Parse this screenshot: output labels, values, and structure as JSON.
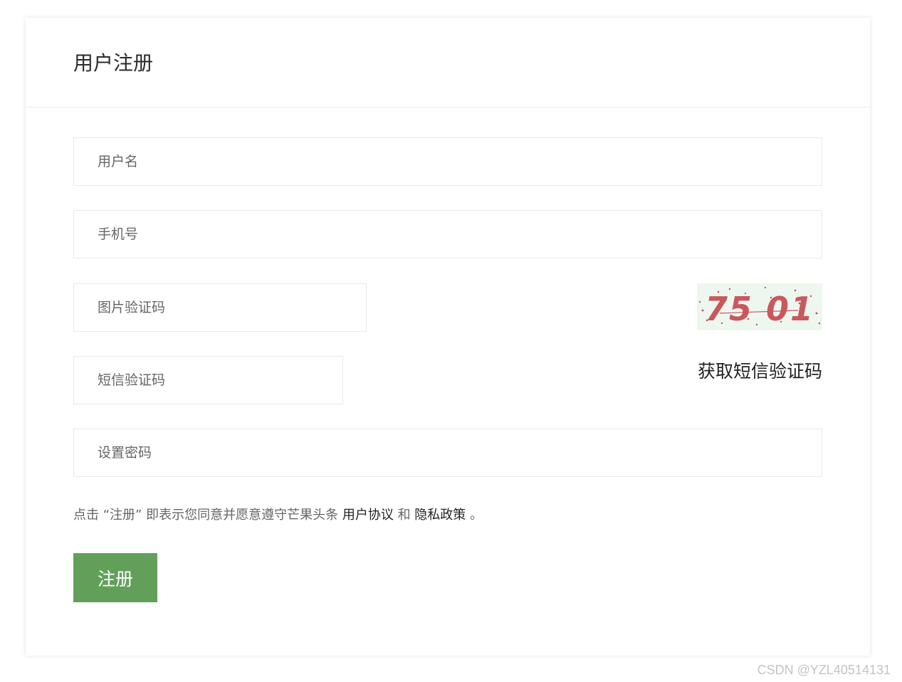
{
  "form": {
    "title": "用户注册",
    "username_placeholder": "用户名",
    "phone_placeholder": "手机号",
    "image_code_placeholder": "图片验证码",
    "sms_code_placeholder": "短信验证码",
    "password_placeholder": "设置密码",
    "captcha_text": "75 01",
    "sms_button_label": "获取短信验证码",
    "agreement": {
      "prefix": "点击 “注册” 即表示您同意并愿意遵守芒果头条",
      "user_agreement_link": "用户协议",
      "and": "和",
      "privacy_link": "隐私政策",
      "suffix": "。"
    },
    "submit_label": "注册"
  },
  "watermark": "CSDN @YZL40514131",
  "colors": {
    "accent_green": "#62a05a",
    "captcha_text": "#c9585d",
    "captcha_bg": "#eef6f0"
  }
}
